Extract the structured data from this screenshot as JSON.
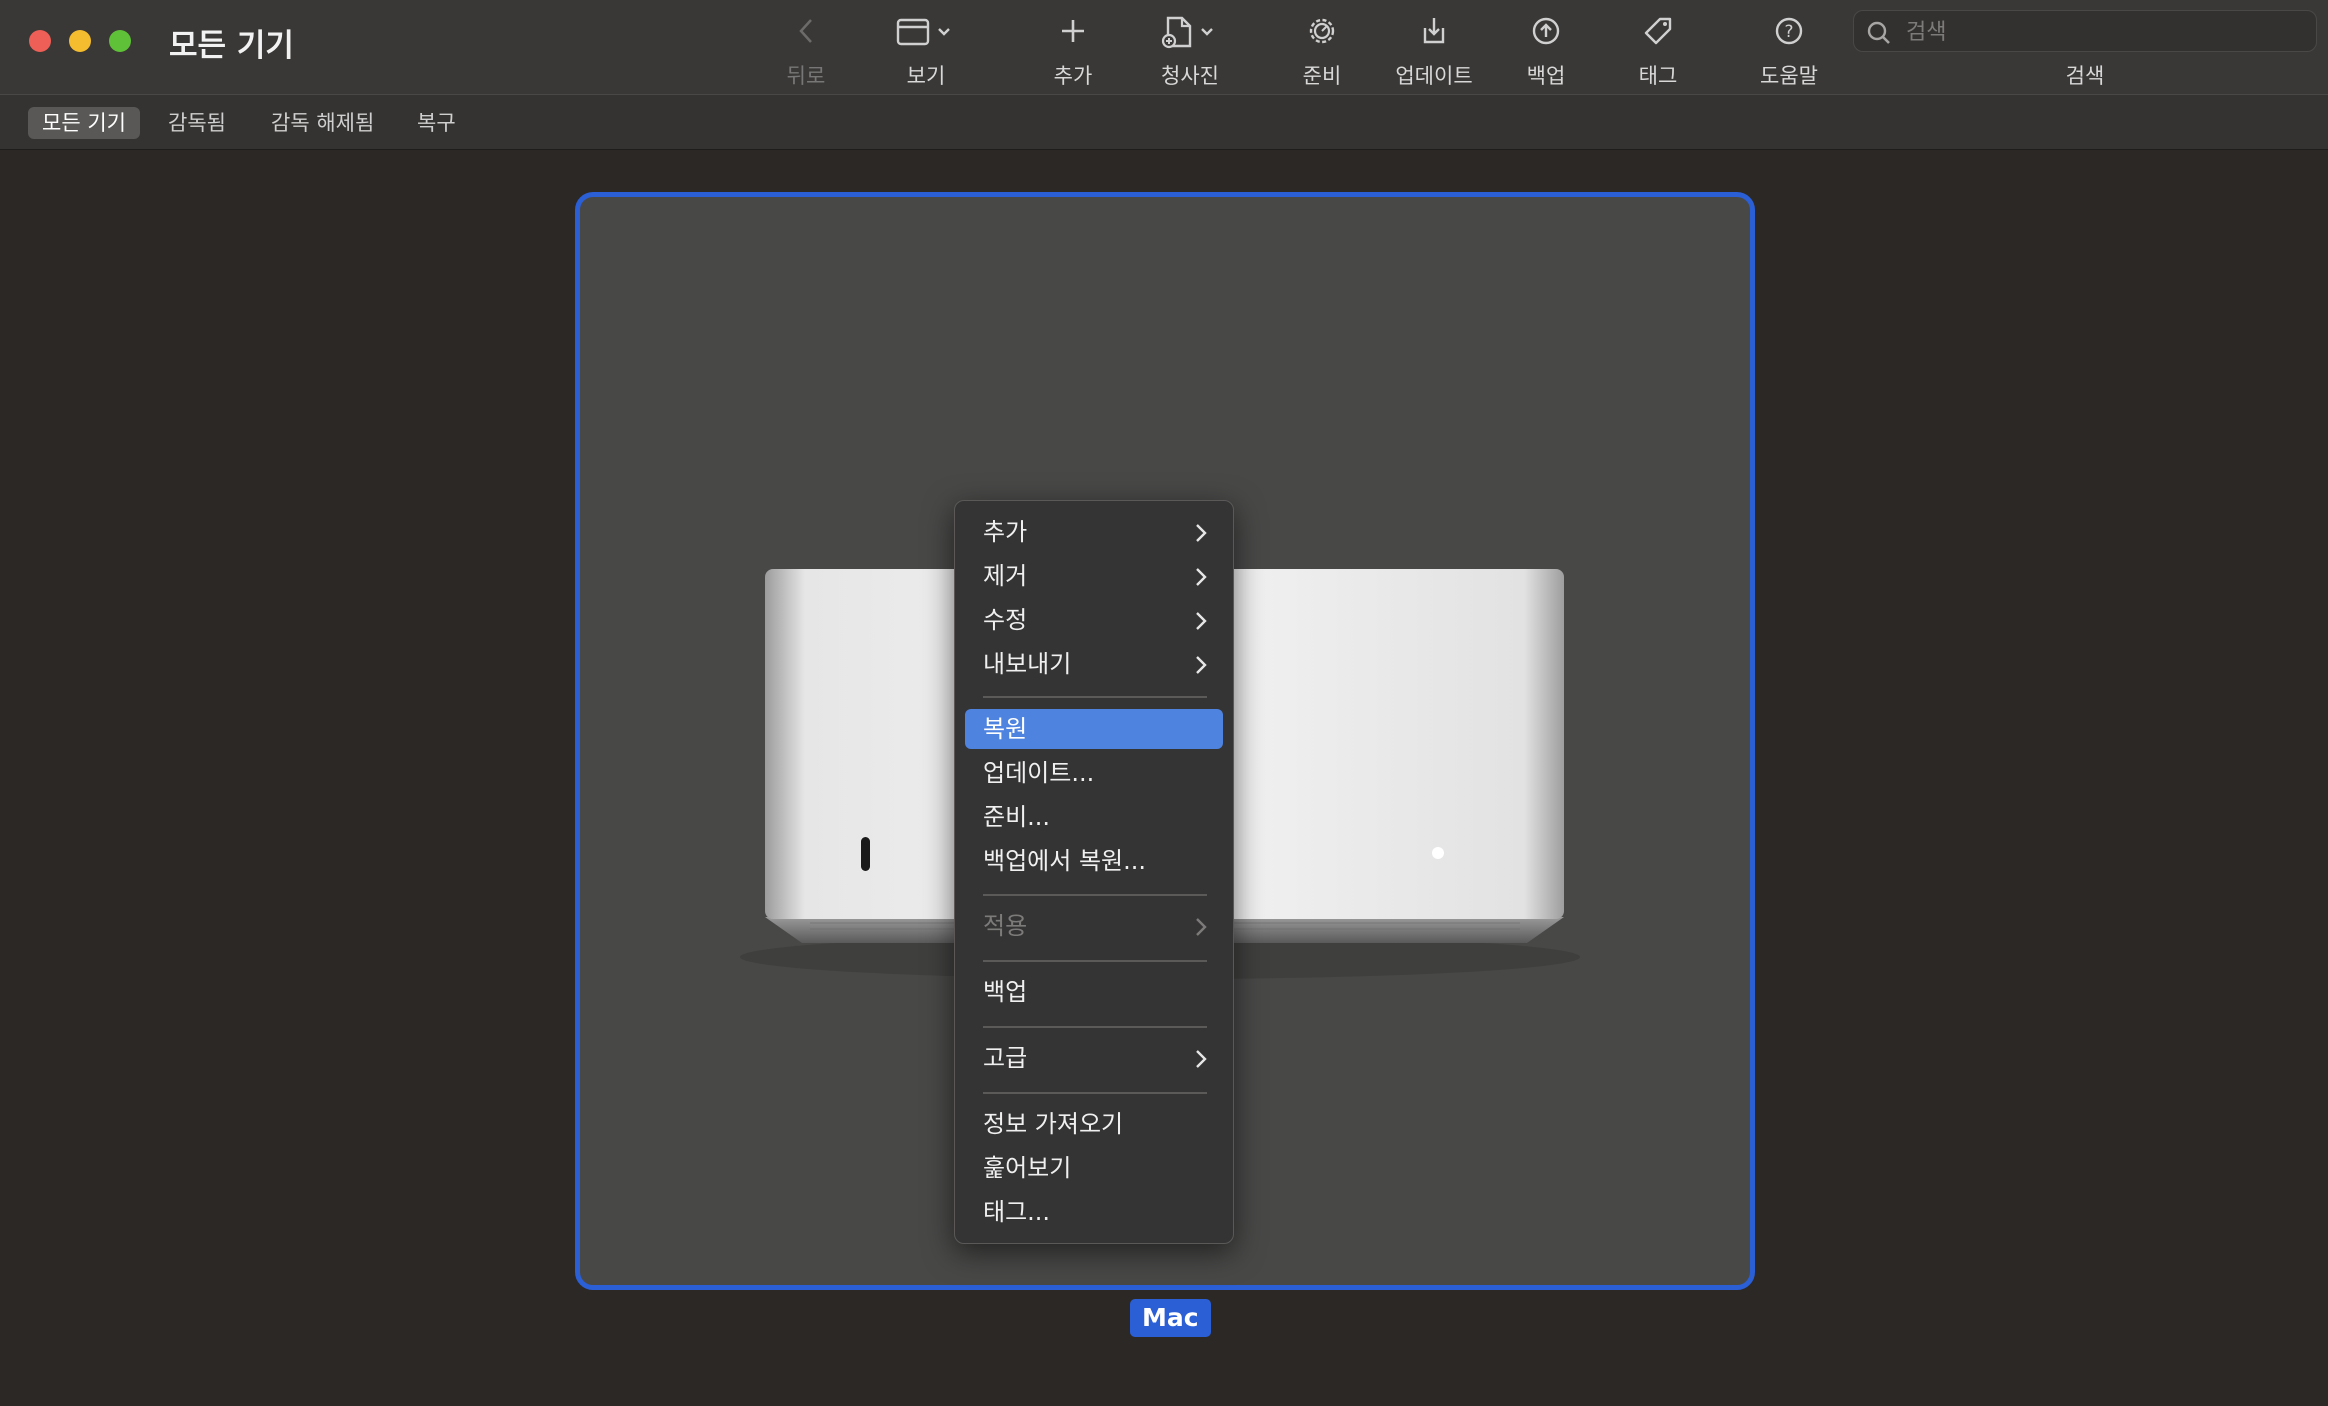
{
  "window": {
    "title": "모든 기기"
  },
  "toolbar": {
    "back_label": "뒤로",
    "view_label": "보기",
    "add_label": "추가",
    "blueprint_label": "청사진",
    "prepare_label": "준비",
    "update_label": "업데이트",
    "backup_label": "백업",
    "tag_label": "태그",
    "help_label": "도움말",
    "search_placeholder": "검색",
    "search_label": "검색"
  },
  "filters": {
    "tabs": [
      {
        "label": "모든 기기",
        "active": true
      },
      {
        "label": "감독됨",
        "active": false
      },
      {
        "label": "감독 해제됨",
        "active": false
      },
      {
        "label": "복구",
        "active": false
      }
    ]
  },
  "device": {
    "label": "Mac"
  },
  "context_menu": {
    "items": [
      {
        "label": "추가",
        "submenu": true
      },
      {
        "label": "제거",
        "submenu": true
      },
      {
        "label": "수정",
        "submenu": true
      },
      {
        "label": "내보내기",
        "submenu": true
      },
      {
        "label": "복원",
        "selected": true
      },
      {
        "label": "업데이트..."
      },
      {
        "label": "준비..."
      },
      {
        "label": "백업에서 복원..."
      },
      {
        "label": "적용",
        "submenu": true,
        "disabled": true
      },
      {
        "label": "백업"
      },
      {
        "label": "고급",
        "submenu": true
      },
      {
        "label": "정보 가져오기"
      },
      {
        "label": "훑어보기"
      },
      {
        "label": "태그..."
      }
    ]
  },
  "colors": {
    "accent": "#2b5fd6",
    "menu_highlight": "#4f83e0",
    "close": "#ee5f57",
    "minimize": "#f4bd2f",
    "zoom": "#5fc138"
  }
}
